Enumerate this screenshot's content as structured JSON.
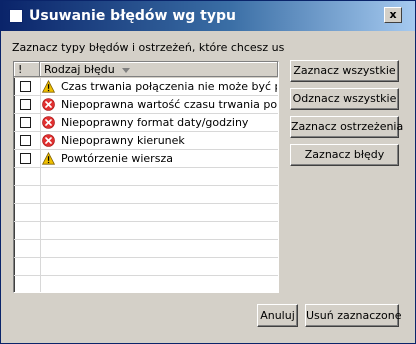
{
  "window": {
    "title": "Usuwanie błędów wg typu",
    "close_label": "x"
  },
  "prompt": "Zaznacz typy błędów i ostrzeżeń, które chcesz usunąć",
  "list": {
    "columns": [
      "!",
      "Rodzaj błędu"
    ],
    "rows": [
      {
        "severity": "warning",
        "icon": "warning-icon",
        "label": "Czas trwania połączenia nie może być pusty",
        "checked": false
      },
      {
        "severity": "error",
        "icon": "error-icon",
        "label": "Niepoprawna wartość czasu trwania połączenia",
        "checked": false
      },
      {
        "severity": "error",
        "icon": "error-icon",
        "label": "Niepoprawny format daty/godziny",
        "checked": false
      },
      {
        "severity": "error",
        "icon": "error-icon",
        "label": "Niepoprawny kierunek",
        "checked": false
      },
      {
        "severity": "warning",
        "icon": "warning-icon",
        "label": "Powtórzenie wiersza",
        "checked": false
      }
    ]
  },
  "buttons": {
    "select_all": "Zaznacz wszystkie",
    "deselect_all": "Odznacz wszystkie",
    "select_warnings": "Zaznacz ostrzeżenia",
    "select_errors": "Zaznacz błędy",
    "cancel": "Anuluj",
    "delete_selected": "Usuń zaznaczone"
  },
  "colors": {
    "title_bar": "#0a246a",
    "warning": "#f0c000",
    "error": "#e03030",
    "face": "#d4d0c8"
  }
}
